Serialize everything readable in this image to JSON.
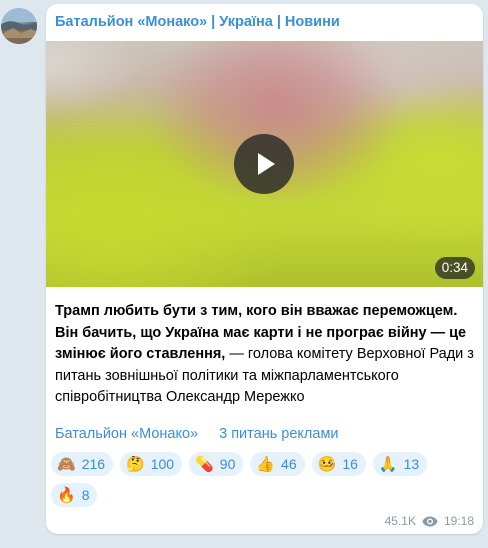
{
  "channel": {
    "name": "Батальйон «Монако» | Україна | Новини"
  },
  "video": {
    "duration": "0:34",
    "play_icon": "play-icon"
  },
  "message": {
    "bold_text": "Трамп любить бути з тим, кого він вважає переможцем. Він бачить, що Україна має карти і не програє війну — це змінює його ставлення,",
    "regular_text": " — голова комітету Верховної Ради з питань зовнішньої політики та міжпарламентського співробітництва Олександр Мережко"
  },
  "links": {
    "channel_link": "Батальйон «Монако»",
    "ads_link": "3 питань реклами"
  },
  "reactions": [
    {
      "emoji": "🙈",
      "count": "216"
    },
    {
      "emoji": "🤔",
      "count": "100"
    },
    {
      "emoji": "💊",
      "count": "90"
    },
    {
      "emoji": "👍",
      "count": "46"
    },
    {
      "emoji": "🤒",
      "count": "16"
    },
    {
      "emoji": "🙏",
      "count": "13"
    },
    {
      "emoji": "🔥",
      "count": "8"
    }
  ],
  "meta": {
    "views": "45.1K",
    "time": "19:18",
    "views_icon": "eye-icon"
  },
  "colors": {
    "accent": "#3a8fd6",
    "background": "#dfe7ee",
    "reaction_bg": "#e5f1fb"
  }
}
